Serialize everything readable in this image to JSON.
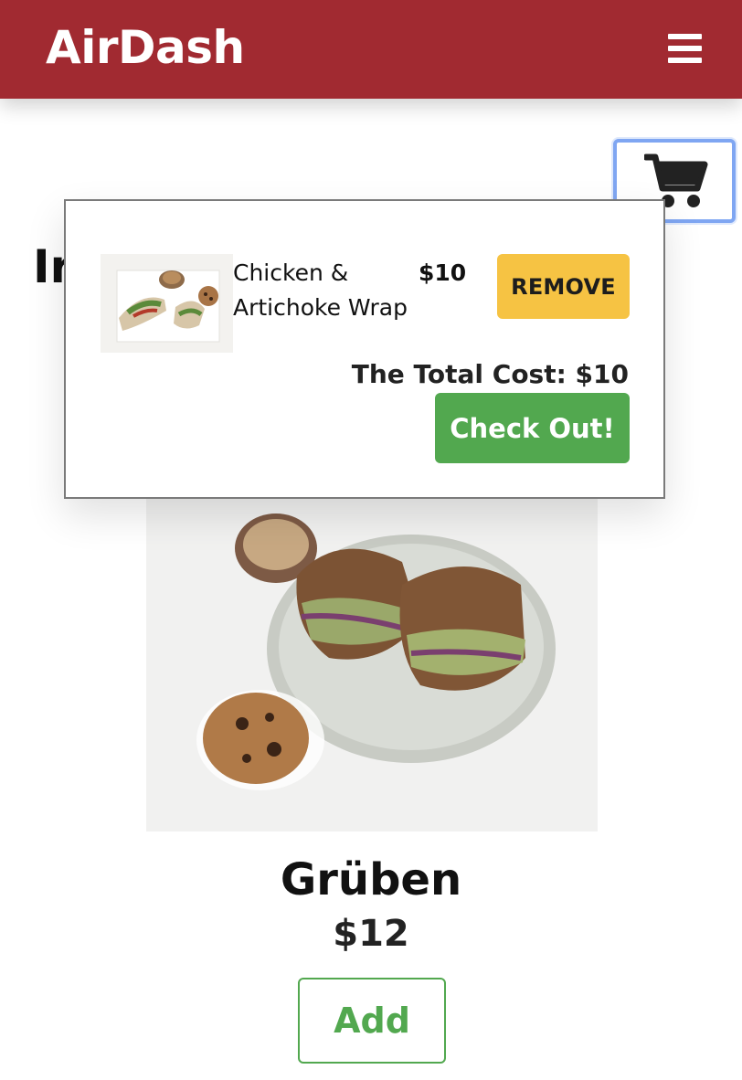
{
  "navbar": {
    "brand": "AirDash",
    "background_color": "#a12a31",
    "menu_icon": "hamburger-menu-icon"
  },
  "cart_button": {
    "icon": "shopping-cart-icon"
  },
  "section": {
    "title_visible": "Ir"
  },
  "cart": {
    "items": [
      {
        "name": "Chicken & Artichoke Wrap",
        "price": "$10",
        "remove_label": "REMOVE",
        "thumbnail": "chicken-wrap-thumbnail"
      }
    ],
    "total_label": "The Total Cost: $10",
    "checkout_label": "Check Out!"
  },
  "product": {
    "name": "Grüben",
    "price": "$12",
    "add_label": "Add",
    "image": "gruben-sandwich-photo"
  },
  "colors": {
    "accent_red": "#a12a31",
    "remove_yellow": "#f6c343",
    "checkout_green": "#52a84f",
    "focus_blue": "#7fa6f2"
  }
}
